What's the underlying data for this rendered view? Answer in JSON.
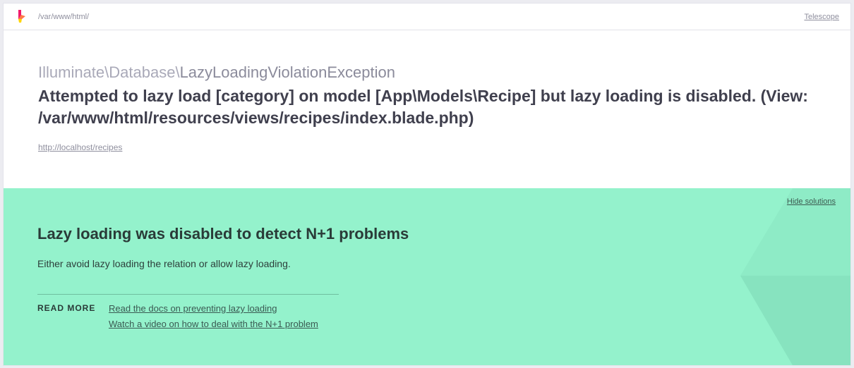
{
  "header": {
    "path": "/var/www/html/",
    "telescope_label": "Telescope"
  },
  "exception": {
    "namespace": "Illuminate\\Database\\",
    "short_class": "LazyLoadingViolationException",
    "message": "Attempted to lazy load [category] on model [App\\Models\\Recipe] but lazy loading is disabled. (View: /var/www/html/resources/views/recipes/index.blade.php)",
    "url": "http://localhost/recipes"
  },
  "solution": {
    "hide_label": "Hide solutions",
    "title": "Lazy loading was disabled to detect N+1 problems",
    "description": "Either avoid lazy loading the relation or allow lazy loading.",
    "read_more_label": "READ MORE",
    "links": [
      {
        "label": "Read the docs on preventing lazy loading"
      },
      {
        "label": "Watch a video on how to deal with the N+1 problem"
      }
    ]
  },
  "colors": {
    "solution_background": "#94f2cc",
    "logo_pink": "#f0196c",
    "logo_yellow": "#ffd500"
  },
  "icons": {
    "brand": "ignition-logo-icon"
  }
}
